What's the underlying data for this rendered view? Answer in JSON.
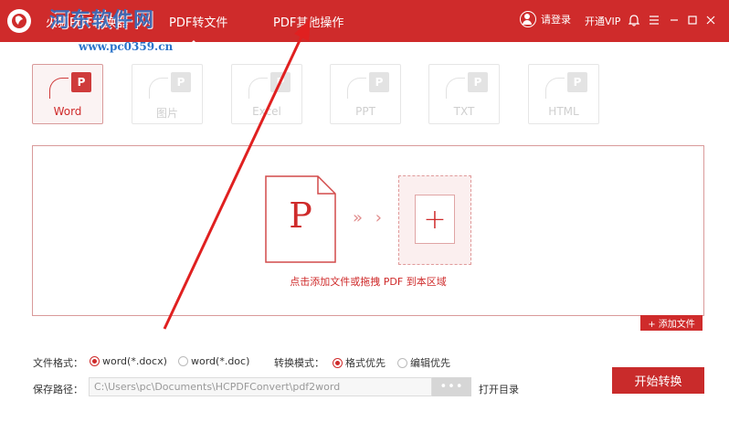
{
  "app": {
    "title": "火狐PDF转换器",
    "watermark_cn": "河东软件网",
    "watermark_url": "www.pc0359.cn"
  },
  "tabs": [
    {
      "label": "PDF转文件",
      "active": true
    },
    {
      "label": "PDF其他操作",
      "active": false
    }
  ],
  "header_right": {
    "login": "请登录",
    "vip": "开通VIP"
  },
  "formats": [
    {
      "label": "Word",
      "badge": "P",
      "active": true
    },
    {
      "label": "图片",
      "badge": "P",
      "active": false
    },
    {
      "label": "Excel",
      "badge": "P",
      "active": false
    },
    {
      "label": "PPT",
      "badge": "P",
      "active": false
    },
    {
      "label": "TXT",
      "badge": "P",
      "active": false
    },
    {
      "label": "HTML",
      "badge": "P",
      "active": false
    }
  ],
  "dropzone": {
    "doc_letter": "P",
    "arrows": "» ›",
    "add_symbol": "+",
    "hint": "点击添加文件或拖拽 PDF 到本区域"
  },
  "add_file_button": "+ 添加文件",
  "options": {
    "file_format_label": "文件格式：",
    "file_formats": [
      {
        "label": "word(*.docx)",
        "checked": true
      },
      {
        "label": "word(*.doc)",
        "checked": false
      }
    ],
    "convert_mode_label": "转换模式：",
    "convert_modes": [
      {
        "label": "格式优先",
        "checked": true
      },
      {
        "label": "编辑优先",
        "checked": false
      }
    ]
  },
  "save": {
    "label": "保存路径：",
    "path": "C:\\Users\\pc\\Documents\\HCPDFConvert\\pdf2word",
    "browse": "•••",
    "open_dir": "打开目录"
  },
  "start_button": "开始转换",
  "colors": {
    "brand": "#cf2b2b",
    "annotation_arrow": "#e02020"
  }
}
